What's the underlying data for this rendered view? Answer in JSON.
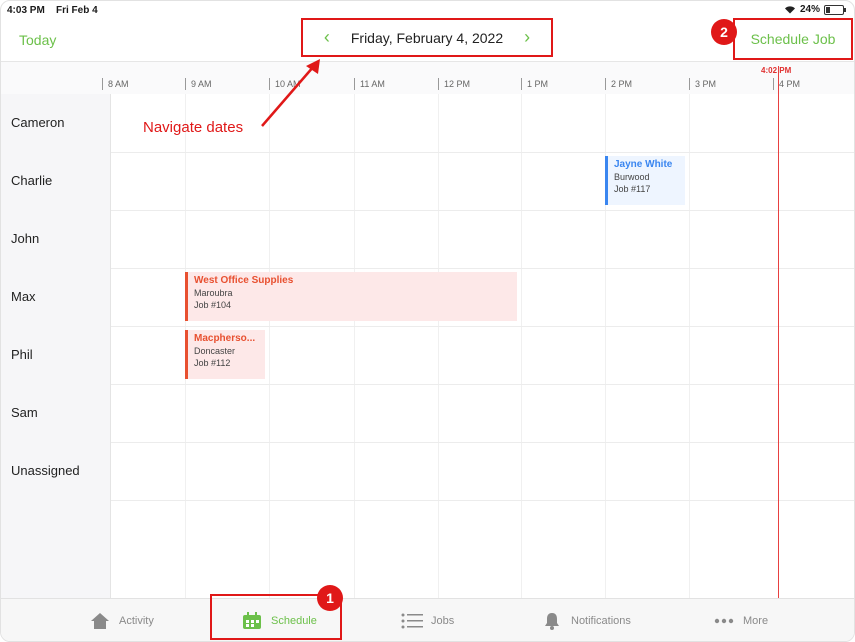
{
  "status": {
    "time": "4:03 PM",
    "date": "Fri Feb 4",
    "battery": "24%",
    "battery_level": 0.24
  },
  "nav": {
    "today": "Today",
    "prev_icon": "chevron-left-icon",
    "next_icon": "chevron-right-icon",
    "date": "Friday, February 4, 2022",
    "schedule_job": "Schedule Job"
  },
  "timeline": {
    "hours": [
      "8 AM",
      "9 AM",
      "10 AM",
      "11 AM",
      "12 PM",
      "1 PM",
      "2 PM",
      "3 PM",
      "4 PM"
    ],
    "now": "4:02 PM"
  },
  "staff": [
    "Cameron",
    "Charlie",
    "John",
    "Max",
    "Phil",
    "Sam",
    "Unassigned"
  ],
  "jobs": [
    {
      "title": "Jayne White",
      "suburb": "Burwood",
      "job": "Job #117",
      "color": "#3a86f0"
    },
    {
      "title": "West Office Supplies",
      "suburb": "Maroubra",
      "job": "Job #104",
      "color": "#e85030"
    },
    {
      "title": "Macpherso...",
      "suburb": "Doncaster",
      "job": "Job #112",
      "color": "#e85030"
    }
  ],
  "annotations": {
    "navigate": "Navigate dates",
    "badge1": "1",
    "badge2": "2"
  },
  "tabs": [
    {
      "label": "Activity",
      "icon": "home-icon"
    },
    {
      "label": "Schedule",
      "icon": "calendar-icon"
    },
    {
      "label": "Jobs",
      "icon": "list-icon"
    },
    {
      "label": "Notifications",
      "icon": "bell-icon"
    },
    {
      "label": "More",
      "icon": "more-dots-icon"
    }
  ],
  "colors": {
    "accent": "#6cc04a",
    "annotation": "#e01818",
    "now_line": "#e84040"
  }
}
